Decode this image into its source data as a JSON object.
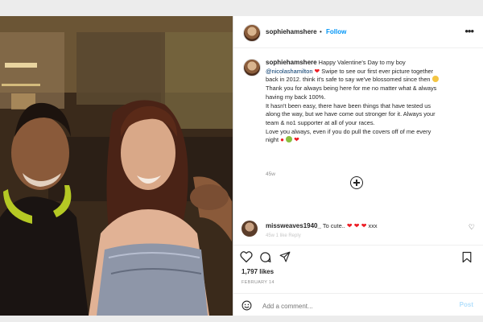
{
  "post": {
    "username": "sophiehamshere",
    "follow_separator": "•",
    "follow_label": "Follow",
    "caption": {
      "username": "sophiehamshere",
      "text_1": "Happy Valentine's Day to my boy",
      "mention": "@nicolashamilton",
      "text_2": "Swipe to see our first ever picture together",
      "line_2": "back in 2012. think it's safe to say we've blossomed since then",
      "line_3": "Thank you for always being here for me no matter what & always",
      "line_4": "having my back 100%.",
      "line_5": "It hasn't been easy, there have been things that have tested us",
      "line_6": "along the way, but we have come out stronger for it. Always your",
      "line_7": "team & no1 supporter at all of your races.",
      "line_8": "Love you always, even if you do pull the covers off of me every",
      "line_9": "night"
    },
    "time_ago": "45w",
    "comment": {
      "username": "missweaves1940_",
      "text": "To cute..",
      "suffix": "xxx",
      "sub": "45w   1 like   Reply"
    },
    "likes": "1,797 likes",
    "date": "FEBRUARY 14",
    "add_comment_placeholder": "Add a comment...",
    "post_label": "Post"
  },
  "icons": {
    "more": "more-options-icon",
    "heart": "heart-icon",
    "comment": "comment-icon",
    "share": "share-icon",
    "save": "bookmark-icon",
    "emoji": "emoji-icon",
    "load_more": "plus-circle-icon"
  },
  "colors": {
    "accent": "#0095f6",
    "mention": "#00376b",
    "heart_emoji": "#ed1c24"
  }
}
